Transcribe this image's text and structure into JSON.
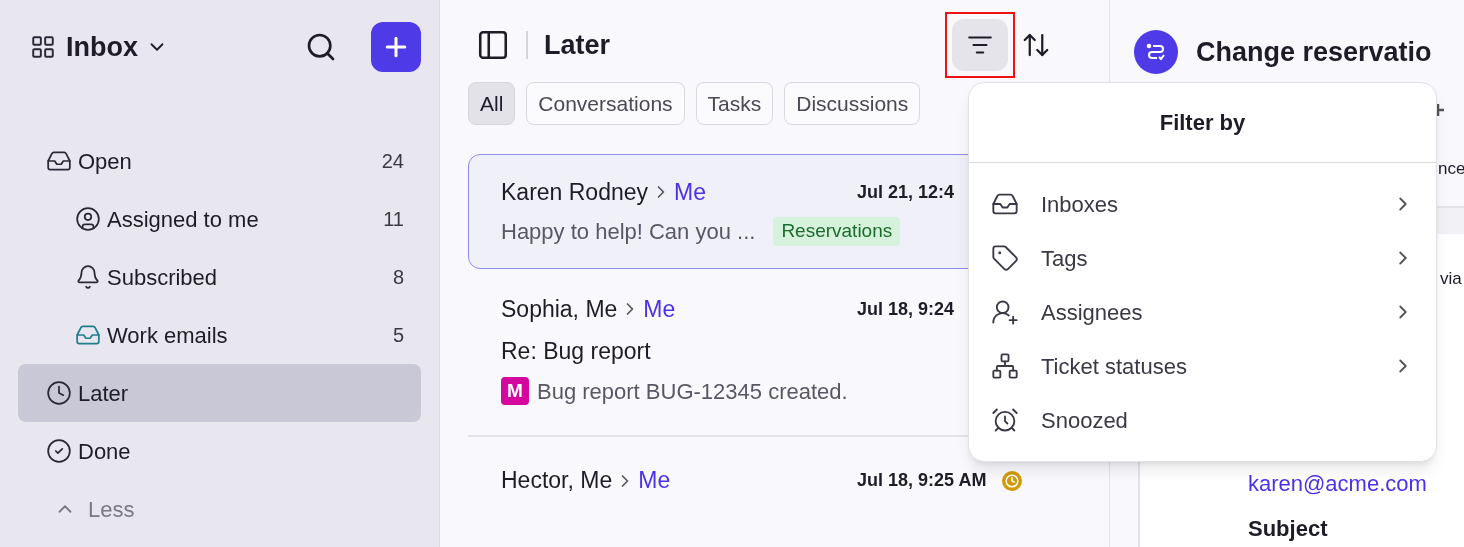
{
  "sidebar": {
    "title": "Inbox",
    "items": [
      {
        "label": "Open",
        "count": "24",
        "selected": false,
        "children": [
          {
            "label": "Assigned to me",
            "count": "11",
            "selected": false
          },
          {
            "label": "Subscribed",
            "count": "8",
            "selected": false
          },
          {
            "label": "Work emails",
            "count": "5",
            "selected": false
          }
        ]
      },
      {
        "label": "Later",
        "selected": true
      },
      {
        "label": "Done",
        "selected": false
      }
    ],
    "less": "Less"
  },
  "list": {
    "title": "Later",
    "filters": [
      {
        "label": "All",
        "selected": true
      },
      {
        "label": "Conversations",
        "selected": false
      },
      {
        "label": "Tasks",
        "selected": false
      },
      {
        "label": "Discussions",
        "selected": false
      }
    ],
    "messages": [
      {
        "from": "Karen Rodney",
        "to": "Me",
        "date": "Jul 21, 12:4",
        "preview": "Happy to help! Can you ...",
        "tag": "Reservations",
        "selected": true
      },
      {
        "from": "Sophia, Me",
        "to": "Me",
        "date": "Jul 18, 9:24",
        "subject": "Re: Bug report",
        "avatar": "M",
        "preview": "Bug report BUG-12345 created.",
        "selected": false
      },
      {
        "from": "Hector, Me",
        "to": "Me",
        "date": "Jul 18, 9:25 AM",
        "selected": false,
        "snoozed": true
      }
    ]
  },
  "filter_menu": {
    "title": "Filter by",
    "items": [
      {
        "label": "Inboxes",
        "submenu": true
      },
      {
        "label": "Tags",
        "submenu": true
      },
      {
        "label": "Assignees",
        "submenu": true
      },
      {
        "label": "Ticket statuses",
        "submenu": true
      },
      {
        "label": "Snoozed",
        "submenu": false
      }
    ]
  },
  "detail": {
    "title": "Change reservatio",
    "fragment_1": "nce",
    "fragment_2": "via",
    "email": "karen@acme.com",
    "subject_label": "Subject"
  }
}
